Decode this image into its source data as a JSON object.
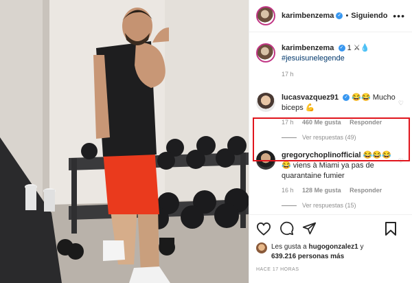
{
  "header": {
    "username": "karimbenzema",
    "verified_icon": "verified-badge-icon",
    "separator": "•",
    "follow_label": "Siguiendo",
    "more_icon": "more-options-icon"
  },
  "caption": {
    "username": "karimbenzema",
    "text": "1 ⚔💧",
    "hashtag": "#jesuisunelegende",
    "time": "17 h"
  },
  "comments": [
    {
      "username": "lucasvazquez91",
      "text": "😂😂 Mucho biceps 💪",
      "time": "17 h",
      "likes": "460 Me gusta",
      "reply_label": "Responder",
      "view_replies": "Ver respuestas (49)",
      "highlighted": true
    },
    {
      "username": "gregorychoplinofficial",
      "text": "😂😂😂😂 viens à Miami ya pas de quarantaine fumier",
      "time": "16 h",
      "likes": "128 Me gusta",
      "reply_label": "Responder",
      "view_replies": "Ver respuestas (15)",
      "highlighted": false
    }
  ],
  "likes": {
    "prefix": "Les gusta a",
    "user": "hugogonzalez1",
    "conj": "y",
    "count": "639.216 personas más"
  },
  "timestamp": "HACE 17 HORAS",
  "colors": {
    "highlight_box": "#e0141c",
    "link": "#00376b",
    "verified": "#3897f0",
    "muted": "#8e8e8e"
  },
  "icons": [
    "heart-icon",
    "comment-icon",
    "share-icon",
    "bookmark-icon"
  ]
}
